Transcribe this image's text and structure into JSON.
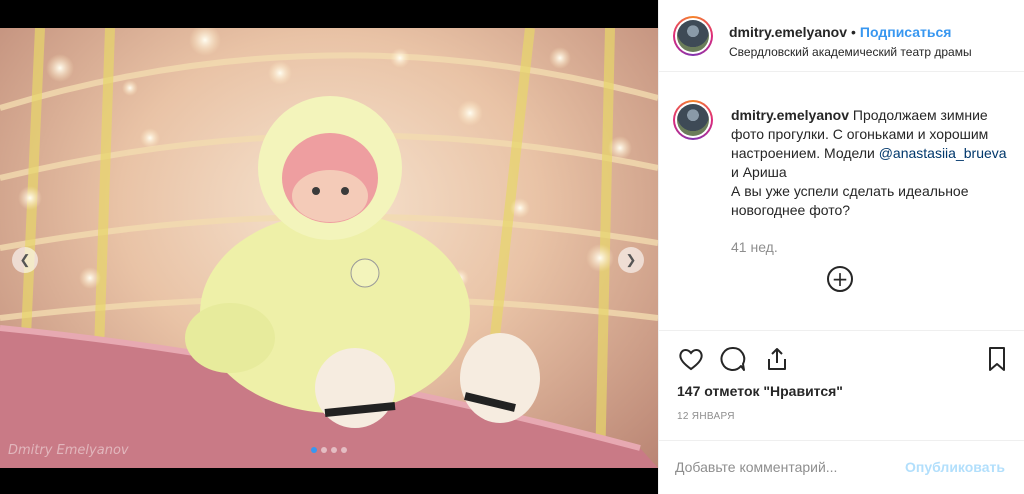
{
  "post": {
    "watermark": "Dmitry Emelyanov",
    "carousel": {
      "slides": 4,
      "active_index": 0
    }
  },
  "header": {
    "username": "dmitry.emelyanov",
    "separator": "•",
    "follow_label": "Подписаться",
    "location": "Свердловский академический театр драмы"
  },
  "caption": {
    "username": "dmitry.emelyanov",
    "text_part1": "Продолжаем зимние фото прогулки. С огоньками и хорошим настроением. Модели ",
    "mention": "@anastasiia_brueva",
    "text_part2": " и Ариша",
    "text_part3": "А вы уже успели сделать идеальное новогоднее фото?",
    "time_ago": "41 нед.",
    "load_more_icon": "+"
  },
  "actions": {
    "icons": [
      "heart-icon",
      "comment-icon",
      "share-icon",
      "bookmark-icon"
    ],
    "likes": "147 отметок \"Нравится\"",
    "date": "12 ЯНВАРЯ"
  },
  "comment": {
    "placeholder": "Добавьте комментарий...",
    "publish_label": "Опубликовать"
  },
  "colors": {
    "accent": "#3897f0",
    "text": "#262626",
    "muted": "#8e8e8e",
    "publish_disabled": "#b2dffc"
  }
}
